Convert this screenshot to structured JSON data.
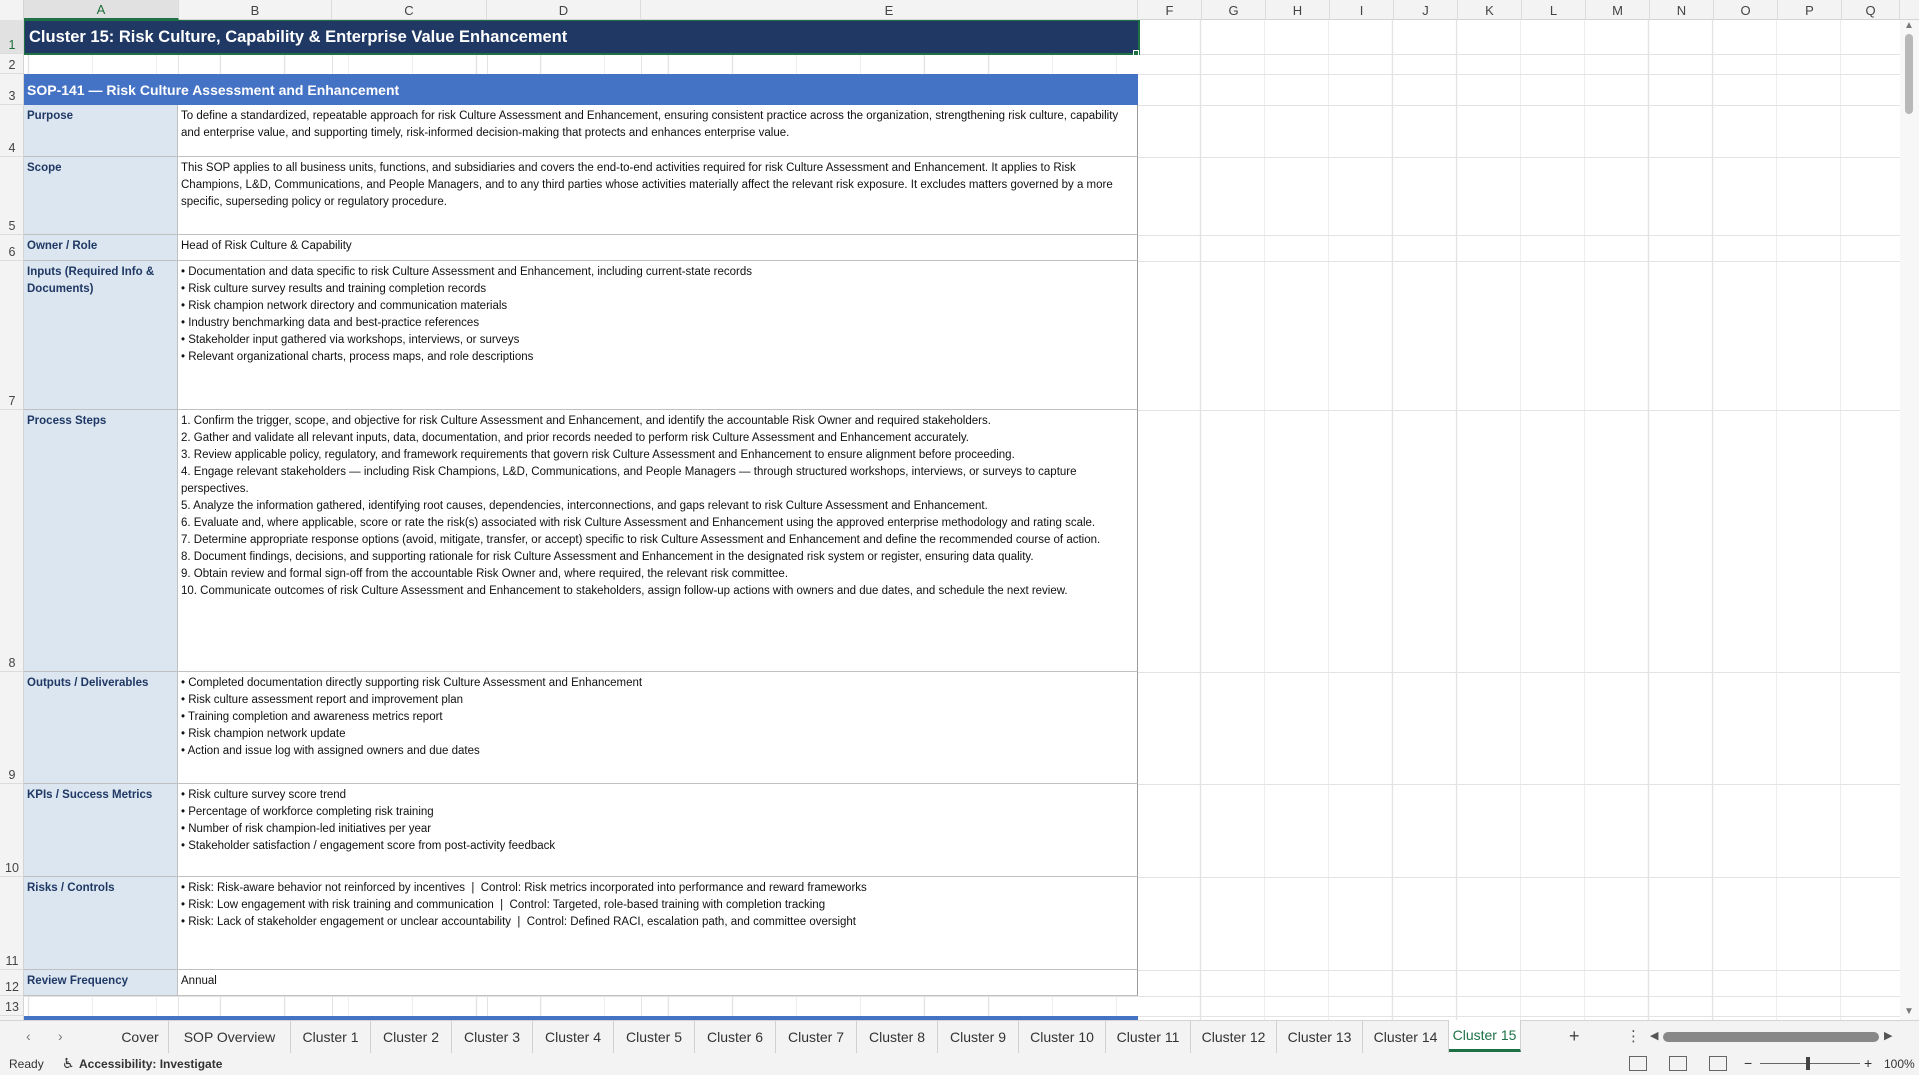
{
  "columns": [
    "A",
    "B",
    "C",
    "D",
    "E",
    "F",
    "G",
    "H",
    "I",
    "J",
    "K",
    "L",
    "M",
    "N",
    "O",
    "P",
    "Q"
  ],
  "rows": [
    "1",
    "2",
    "3",
    "4",
    "5",
    "6",
    "7",
    "8",
    "9",
    "10",
    "11",
    "12",
    "13"
  ],
  "title": "Cluster 15: Risk Culture, Capability & Enterprise Value Enhancement",
  "section": "SOP-141  —  Risk Culture Assessment and Enhancement",
  "fields": {
    "purpose": {
      "label": "Purpose",
      "value": "To define a standardized, repeatable approach for risk Culture Assessment and Enhancement, ensuring consistent practice across the organization, strengthening risk culture, capability and enterprise value, and supporting timely, risk-informed decision-making that protects and enhances enterprise value."
    },
    "scope": {
      "label": "Scope",
      "value": "This SOP applies to all business units, functions, and subsidiaries and covers the end-to-end activities required for risk Culture Assessment and Enhancement. It applies to Risk Champions, L&D, Communications, and People Managers, and to any third parties whose activities materially affect the relevant risk exposure. It excludes matters governed by a more specific, superseding policy or regulatory procedure."
    },
    "owner": {
      "label": "Owner / Role",
      "value": "Head of Risk Culture & Capability"
    },
    "inputs": {
      "label": "Inputs (Required Info & Documents)",
      "value": "• Documentation and data specific to risk Culture Assessment and Enhancement, including current-state records\n• Risk culture survey results and training completion records\n• Risk champion network directory and communication materials\n• Industry benchmarking data and best-practice references\n• Stakeholder input gathered via workshops, interviews, or surveys\n• Relevant organizational charts, process maps, and role descriptions"
    },
    "process": {
      "label": "Process Steps",
      "value": "1. Confirm the trigger, scope, and objective for risk Culture Assessment and Enhancement, and identify the accountable Risk Owner and required stakeholders.\n2. Gather and validate all relevant inputs, data, documentation, and prior records needed to perform risk Culture Assessment and Enhancement accurately.\n3. Review applicable policy, regulatory, and framework requirements that govern risk Culture Assessment and Enhancement to ensure alignment before proceeding.\n4. Engage relevant stakeholders — including Risk Champions, L&D, Communications, and People Managers — through structured workshops, interviews, or surveys to capture perspectives.\n5. Analyze the information gathered, identifying root causes, dependencies, interconnections, and gaps relevant to risk Culture Assessment and Enhancement.\n6. Evaluate and, where applicable, score or rate the risk(s) associated with risk Culture Assessment and Enhancement using the approved enterprise methodology and rating scale.\n7. Determine appropriate response options (avoid, mitigate, transfer, or accept) specific to risk Culture Assessment and Enhancement and define the recommended course of action.\n8. Document findings, decisions, and supporting rationale for risk Culture Assessment and Enhancement in the designated risk system or register, ensuring data quality.\n9. Obtain review and formal sign-off from the accountable Risk Owner and, where required, the relevant risk committee.\n10. Communicate outcomes of risk Culture Assessment and Enhancement to stakeholders, assign follow-up actions with owners and due dates, and schedule the next review."
    },
    "outputs": {
      "label": "Outputs / Deliverables",
      "value": "• Completed documentation directly supporting risk Culture Assessment and Enhancement\n• Risk culture assessment report and improvement plan\n• Training completion and awareness metrics report\n• Risk champion network update\n• Action and issue log with assigned owners and due dates"
    },
    "kpis": {
      "label": "KPIs / Success Metrics",
      "value": "• Risk culture survey score trend\n• Percentage of workforce completing risk training\n• Number of risk champion-led initiatives per year\n• Stakeholder satisfaction / engagement score from post-activity feedback"
    },
    "risks": {
      "label": "Risks / Controls",
      "value": "• Risk: Risk-aware behavior not reinforced by incentives  |  Control: Risk metrics incorporated into performance and reward frameworks\n• Risk: Low engagement with risk training and communication  |  Control: Targeted, role-based training with completion tracking\n• Risk: Lack of stakeholder engagement or unclear accountability  |  Control: Defined RACI, escalation path, and committee oversight"
    },
    "review": {
      "label": "Review Frequency",
      "value": "Annual"
    }
  },
  "tabs": [
    "Cover",
    "SOP Overview",
    "Cluster 1",
    "Cluster 2",
    "Cluster 3",
    "Cluster 4",
    "Cluster 5",
    "Cluster 6",
    "Cluster 7",
    "Cluster 8",
    "Cluster 9",
    "Cluster 10",
    "Cluster 11",
    "Cluster 12",
    "Cluster 13",
    "Cluster 14",
    "Cluster 15"
  ],
  "active_tab": "Cluster 15",
  "status": {
    "ready": "Ready",
    "accessibility": "Accessibility: Investigate",
    "zoom": "100%"
  },
  "icons": {
    "tab_prev": "chevron-left-icon",
    "tab_next": "chevron-right-icon",
    "add": "plus-icon",
    "more": "vertical-dots-icon",
    "accessibility": "accessibility-icon"
  },
  "colors": {
    "title_bg": "#1f3864",
    "section_bg": "#4472c4",
    "label_bg": "#dce6f1",
    "accent": "#1e7145"
  }
}
